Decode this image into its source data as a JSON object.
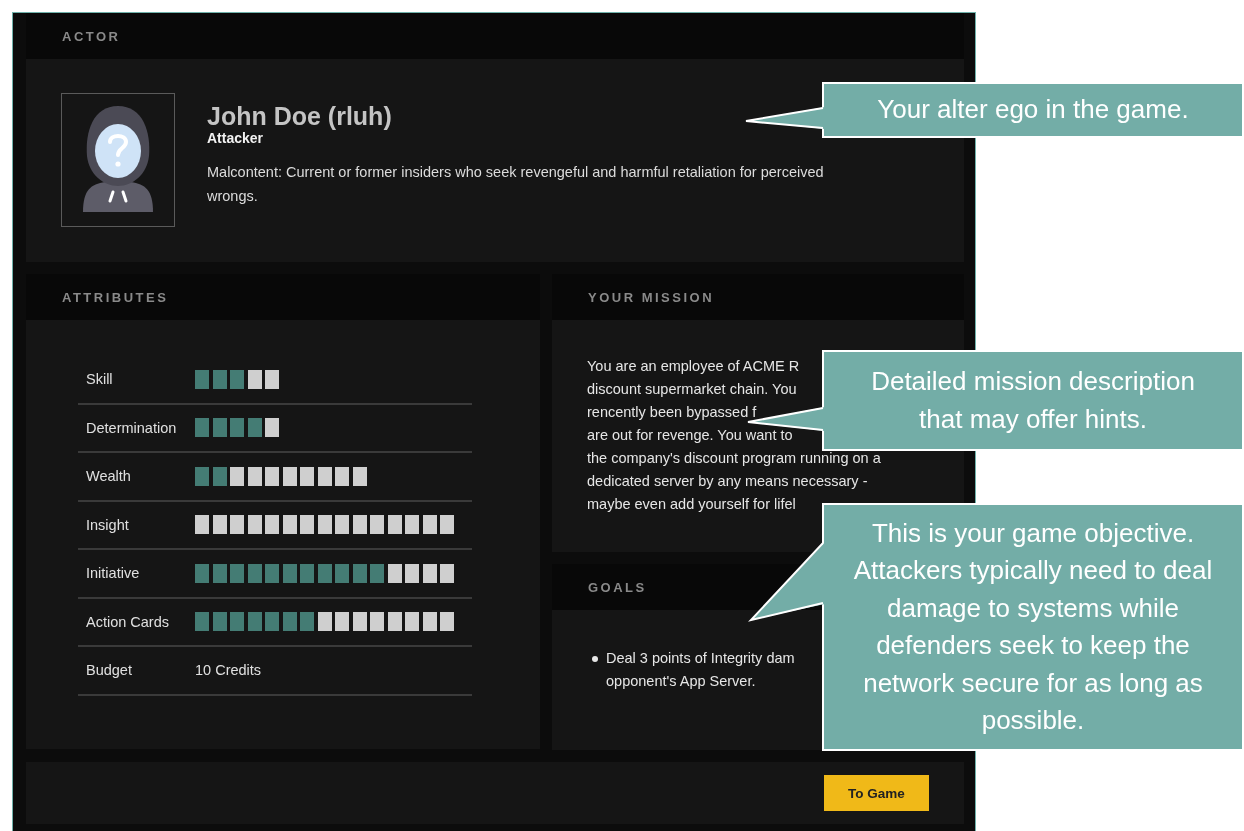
{
  "actor": {
    "heading": "ACTOR",
    "name": "John Doe (rluh)",
    "role": "Attacker",
    "description": "Malcontent: Current or former insiders who seek revengeful and harmful retaliation for perceived wrongs."
  },
  "attributes": {
    "heading": "ATTRIBUTES",
    "rows": [
      {
        "label": "Skill",
        "kind": "pips",
        "pips": [
          true,
          true,
          true,
          false,
          false
        ]
      },
      {
        "label": "Determination",
        "kind": "pips",
        "pips": [
          true,
          true,
          true,
          true,
          false
        ]
      },
      {
        "label": "Wealth",
        "kind": "pips",
        "pips": [
          true,
          true,
          false,
          false,
          false,
          false,
          false,
          false,
          false,
          false
        ]
      },
      {
        "label": "Insight",
        "kind": "pips",
        "pips": [
          false,
          false,
          false,
          false,
          false,
          false,
          false,
          false,
          false,
          false,
          false,
          false,
          false,
          false,
          false
        ]
      },
      {
        "label": "Initiative",
        "kind": "pips",
        "pips": [
          true,
          true,
          true,
          true,
          true,
          true,
          true,
          true,
          true,
          true,
          true,
          false,
          false,
          false,
          false
        ]
      },
      {
        "label": "Action Cards",
        "kind": "pips",
        "pips": [
          true,
          true,
          true,
          true,
          true,
          true,
          true,
          false,
          false,
          false,
          false,
          false,
          false,
          false,
          false
        ]
      },
      {
        "label": "Budget",
        "kind": "text",
        "value": "10 Credits"
      }
    ]
  },
  "mission": {
    "heading": "YOUR MISSION",
    "lines": [
      "You are an employee of ACME R",
      "discount supermarket chain. You",
      "rencently been bypassed f",
      "are out for revenge. You want to",
      "the company's discount program running on a",
      "dedicated server by any means necessary -",
      "maybe even add yourself for lifel"
    ]
  },
  "goals": {
    "heading": "GOALS",
    "items": [
      {
        "lines": [
          "Deal 3 points of Integrity dam",
          "opponent's App Server."
        ]
      }
    ]
  },
  "footer": {
    "button": "To Game"
  },
  "callouts": [
    {
      "text": "Your alter ego in the game."
    },
    {
      "text": "Detailed mission description that may offer hints."
    },
    {
      "text": "This is your game objective. Attackers typically need to deal damage to systems while defenders seek to keep the network secure for as long as possible."
    }
  ]
}
